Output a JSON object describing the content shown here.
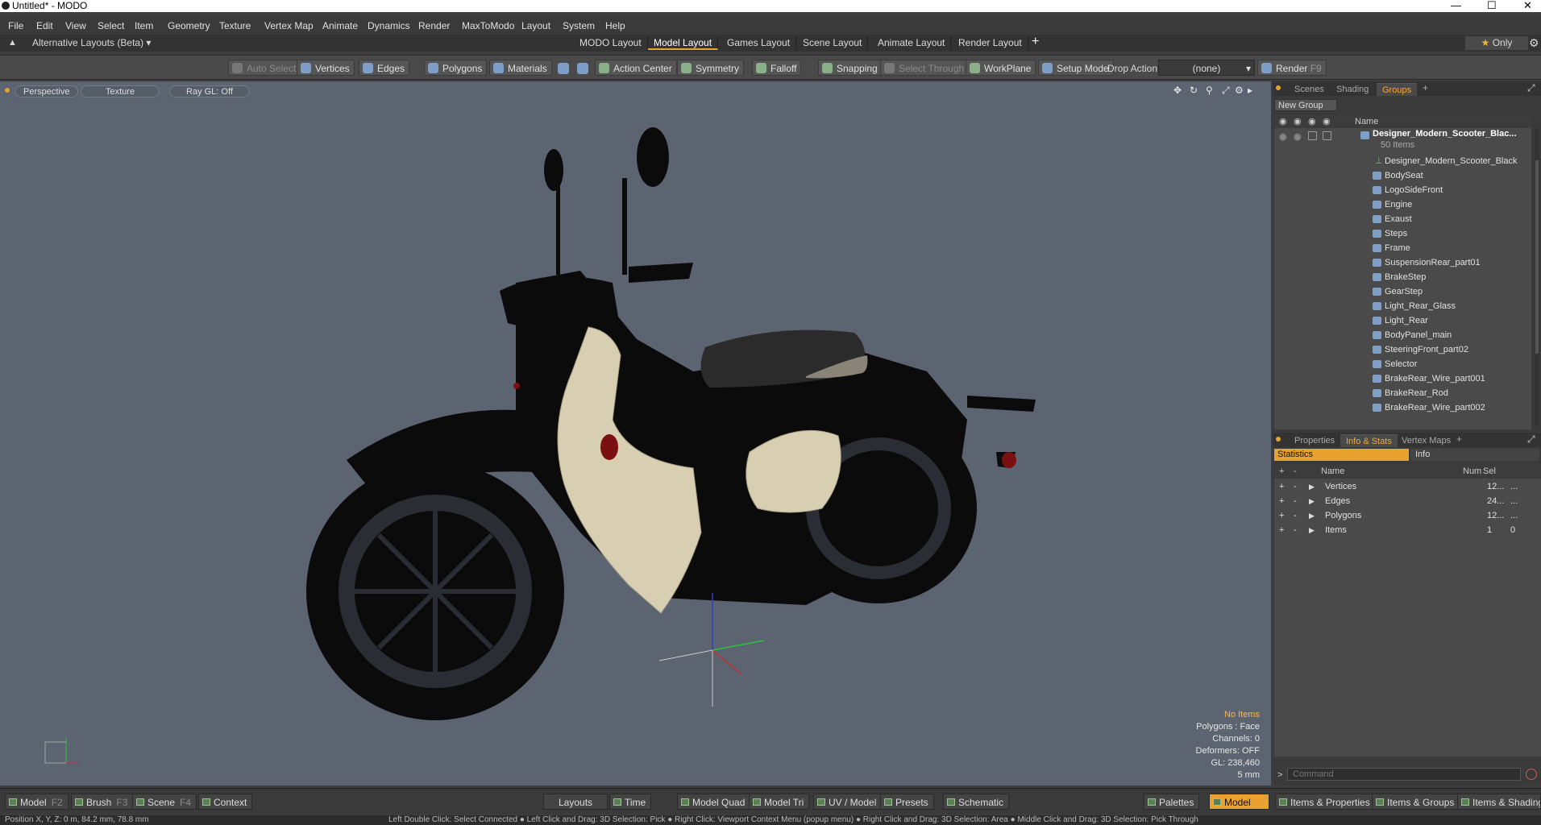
{
  "window": {
    "title": "Untitled* - MODO"
  },
  "menu": [
    "File",
    "Edit",
    "View",
    "Select",
    "Item",
    "Geometry",
    "Texture",
    "Vertex Map",
    "Animate",
    "Dynamics",
    "Render",
    "MaxToModo",
    "Layout",
    "System",
    "Help"
  ],
  "layouts": {
    "preset": "Alternative Layouts (Beta)",
    "tabs": [
      "MODO Layout",
      "Model Layout",
      "Games Layout",
      "Scene Layout",
      "Animate Layout",
      "Render Layout"
    ],
    "only_label": "Only"
  },
  "toolbar": {
    "auto_select": "Auto Select",
    "vertices": "Vertices",
    "edges": "Edges",
    "polygons": "Polygons",
    "materials": "Materials",
    "action_center": "Action Center",
    "symmetry": "Symmetry",
    "falloff": "Falloff",
    "snapping": "Snapping",
    "select_through": "Select Through",
    "workplane": "WorkPlane",
    "setup_mode": "Setup Mode",
    "drop_action": "Drop Action",
    "drop_value": "(none)",
    "render": "Render",
    "render_key": "F9"
  },
  "viewport": {
    "view": "Perspective",
    "shading": "Texture",
    "raygl": "Ray GL: Off",
    "stats": {
      "items": "No Items",
      "polygons": "Polygons : Face",
      "channels": "Channels: 0",
      "deformers": "Deformers: OFF",
      "gl": "GL: 238,460",
      "scale": "5 mm"
    }
  },
  "scene_panel": {
    "tabs": [
      "Scenes",
      "Shading",
      "Groups"
    ],
    "new_group": "New Group",
    "name_header": "Name",
    "group": {
      "name": "Designer_Modern_Scooter_Blac...",
      "count": "50 Items"
    },
    "items": [
      "Designer_Modern_Scooter_Black",
      "BodySeat",
      "LogoSideFront",
      "Engine",
      "Exaust",
      "Steps",
      "Frame",
      "SuspensionRear_part01",
      "BrakeStep",
      "GearStep",
      "Light_Rear_Glass",
      "Light_Rear",
      "BodyPanel_main",
      "SteeringFront_part02",
      "Selector",
      "BrakeRear_Wire_part001",
      "BrakeRear_Rod",
      "BrakeRear_Wire_part002"
    ]
  },
  "info_panel": {
    "tabs": [
      "Properties",
      "Info & Stats",
      "Vertex Maps"
    ],
    "subtabs": [
      "Statistics",
      "Info"
    ],
    "headers": {
      "name": "Name",
      "num": "Num",
      "sel": "Sel"
    },
    "rows": [
      {
        "name": "Vertices",
        "num": "12...",
        "sel": "..."
      },
      {
        "name": "Edges",
        "num": "24...",
        "sel": "..."
      },
      {
        "name": "Polygons",
        "num": "12...",
        "sel": "..."
      },
      {
        "name": "Items",
        "num": "1",
        "sel": "0"
      }
    ],
    "command_placeholder": "Command"
  },
  "bottom": {
    "model": "Model",
    "model_key": "F2",
    "brush": "Brush",
    "brush_key": "F3",
    "scene": "Scene",
    "scene_key": "F4",
    "context": "Context",
    "layouts": "Layouts",
    "time": "Time",
    "model_quad": "Model Quad",
    "model_tri": "Model Tri",
    "uv_model": "UV / Model",
    "presets": "Presets",
    "schematic": "Schematic",
    "palettes": "Palettes",
    "model_active": "Model",
    "items_props": "Items & Properties",
    "items_groups": "Items & Groups",
    "items_shading": "Items & Shading"
  },
  "status": {
    "left": "Position X, Y, Z:   0 m, 84.2 mm, 78.8 mm",
    "hint": "Left Double Click: Select Connected ● Left Click and Drag: 3D Selection: Pick ● Right Click: Viewport Context Menu (popup menu) ● Right Click and Drag: 3D Selection: Area ● Middle Click and Drag: 3D Selection: Pick Through"
  }
}
